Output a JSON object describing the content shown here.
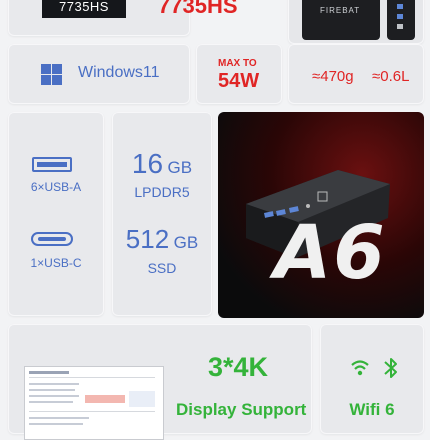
{
  "top": {
    "cpu_badge": "7735HS",
    "cpu_red": "7735HS",
    "device_label": "FIREBAT"
  },
  "row2": {
    "os": "Windows11",
    "power_max_label": "MAX TO",
    "power_value": "54W",
    "weight": "≈470g",
    "volume": "≈0.6L"
  },
  "ports": {
    "usba_label": "6×USB-A",
    "usbc_label": "1×USB-C"
  },
  "memory": {
    "ram_value": "16",
    "ram_unit": "GB",
    "ram_type": "LPDDR5",
    "ssd_value": "512",
    "ssd_unit": "GB",
    "ssd_type": "SSD"
  },
  "hero": {
    "model": "A6"
  },
  "bottom": {
    "display_count": "3*4K",
    "display_label": "Display Support",
    "wifi_label": "Wifi 6"
  },
  "colors": {
    "red": "#e02525",
    "blue": "#4a6fc4",
    "green": "#34b33a"
  }
}
